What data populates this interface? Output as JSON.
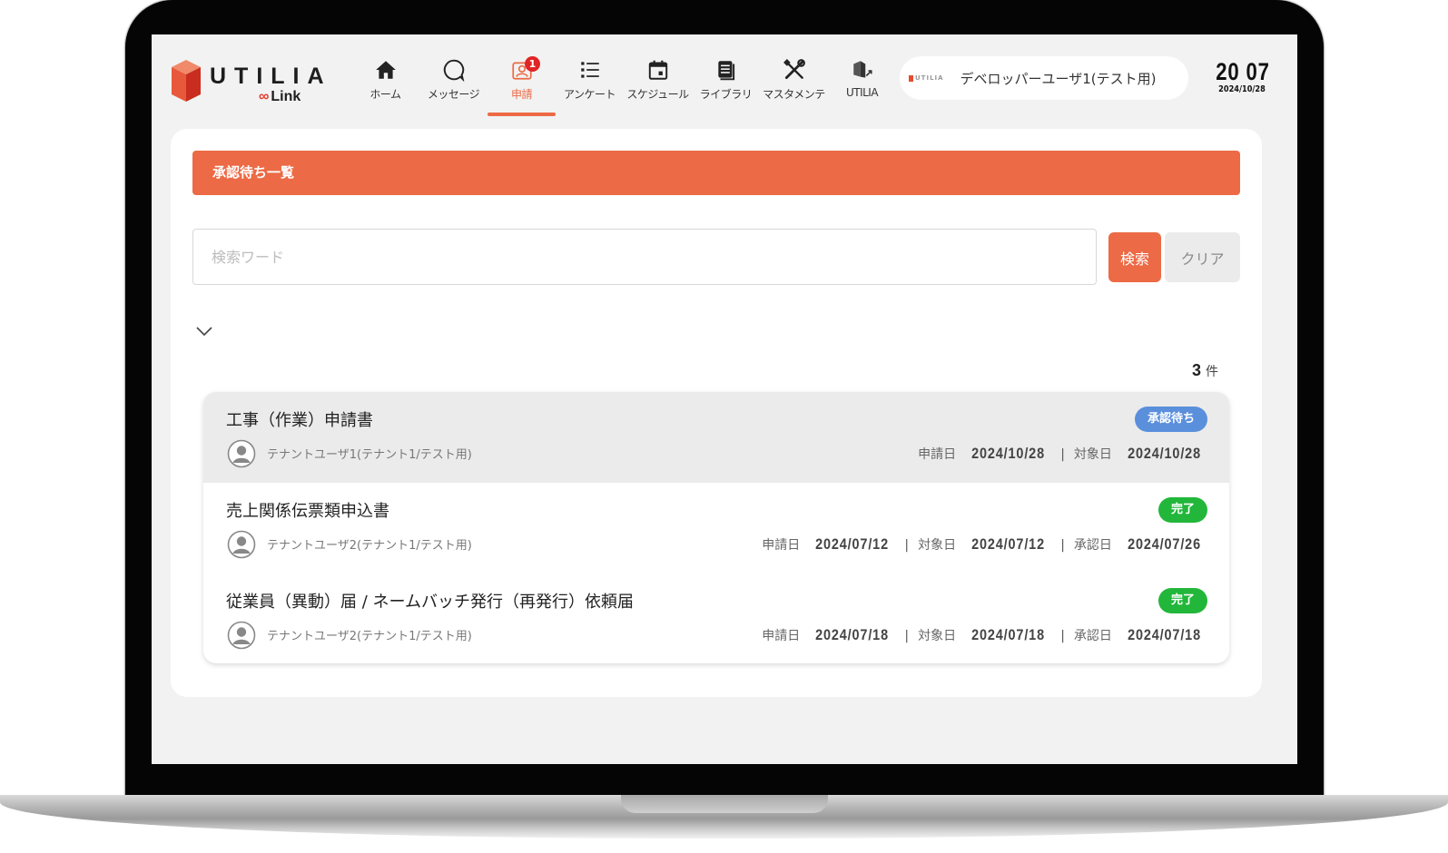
{
  "header": {
    "logo": {
      "text": "UTILIA",
      "sub": "Link"
    },
    "nav": [
      {
        "label": "ホーム",
        "icon": "home-icon"
      },
      {
        "label": "メッセージ",
        "icon": "message-icon"
      },
      {
        "label": "申請",
        "icon": "application-icon",
        "badge": "1",
        "active": true
      },
      {
        "label": "アンケート",
        "icon": "survey-list-icon"
      },
      {
        "label": "スケジュール",
        "icon": "calendar-icon"
      },
      {
        "label": "ライブラリ",
        "icon": "library-icon"
      },
      {
        "label": "マスタメンテ",
        "icon": "tools-icon"
      },
      {
        "label": "UTILIA",
        "icon": "external-link-icon"
      }
    ],
    "user": {
      "mini_logo": "UTILIA",
      "name": "デベロッパーユーザ1(テスト用)"
    },
    "clock": {
      "time": "20 07",
      "date": "2024/10/28"
    }
  },
  "page": {
    "title": "承認待ち一覧",
    "search": {
      "placeholder": "検索ワード",
      "value": ""
    },
    "search_button": "検索",
    "clear_button": "クリア",
    "count": {
      "value": "3",
      "unit": "件"
    }
  },
  "items": [
    {
      "title": "工事（作業）申請書",
      "user": "テナントユーザ1(テナント1/テスト用)",
      "status": "承認待ち",
      "status_color": "#5a8fdc",
      "applied_label": "申請日",
      "applied": "2024/10/28",
      "target_label": "対象日",
      "target": "2024/10/28",
      "approved_label": "",
      "approved": ""
    },
    {
      "title": "売上関係伝票類申込書",
      "user": "テナントユーザ2(テナント1/テスト用)",
      "status": "完了",
      "status_color": "#22b73a",
      "applied_label": "申請日",
      "applied": "2024/07/12",
      "target_label": "対象日",
      "target": "2024/07/12",
      "approved_label": "承認日",
      "approved": "2024/07/26"
    },
    {
      "title": "従業員（異動）届 / ネームバッチ発行（再発行）依頼届",
      "user": "テナントユーザ2(テナント1/テスト用)",
      "status": "完了",
      "status_color": "#22b73a",
      "applied_label": "申請日",
      "applied": "2024/07/18",
      "target_label": "対象日",
      "target": "2024/07/18",
      "approved_label": "承認日",
      "approved": "2024/07/18"
    }
  ],
  "colors": {
    "accent": "#ec6a45",
    "pending": "#5a8fdc",
    "done": "#22b73a",
    "badge": "#e02424"
  }
}
